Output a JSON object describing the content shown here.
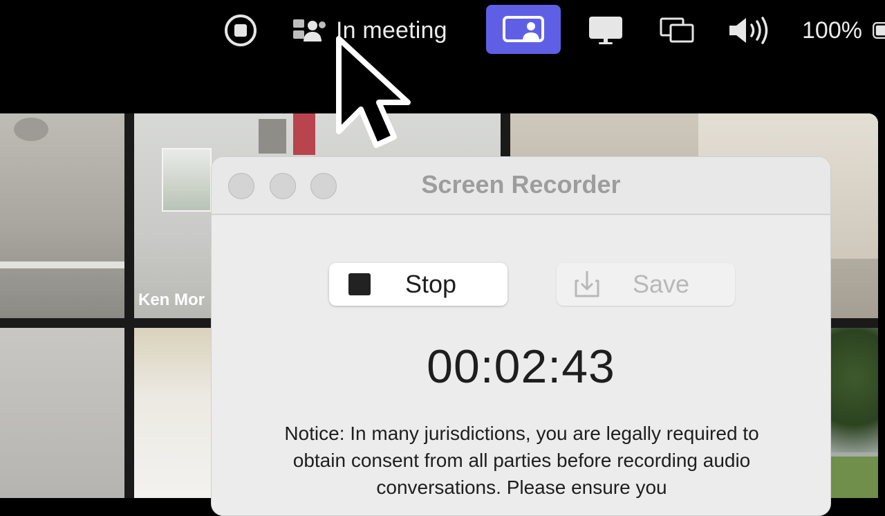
{
  "menubar": {
    "meeting_label": "In meeting",
    "battery_percent": "100%",
    "icons": {
      "record": "stop-record-icon",
      "meeting": "meeting-participants-icon",
      "share": "screen-share-icon",
      "display": "display-icon",
      "mirror": "screen-mirroring-icon",
      "volume": "volume-icon",
      "battery": "battery-icon"
    },
    "share_active_color": "#5f5fe6"
  },
  "gallery": {
    "tiles": [
      {
        "name": ""
      },
      {
        "name": "Ken Mor"
      },
      {
        "name": ""
      },
      {
        "name": ""
      },
      {
        "name": ""
      },
      {
        "name": ""
      }
    ]
  },
  "recorder": {
    "title": "Screen Recorder",
    "stop_label": "Stop",
    "save_label": "Save",
    "timer": "00:02:43",
    "notice": "Notice: In many jurisdictions, you are legally required to obtain consent from all parties before recording audio conversations. Please ensure you"
  }
}
